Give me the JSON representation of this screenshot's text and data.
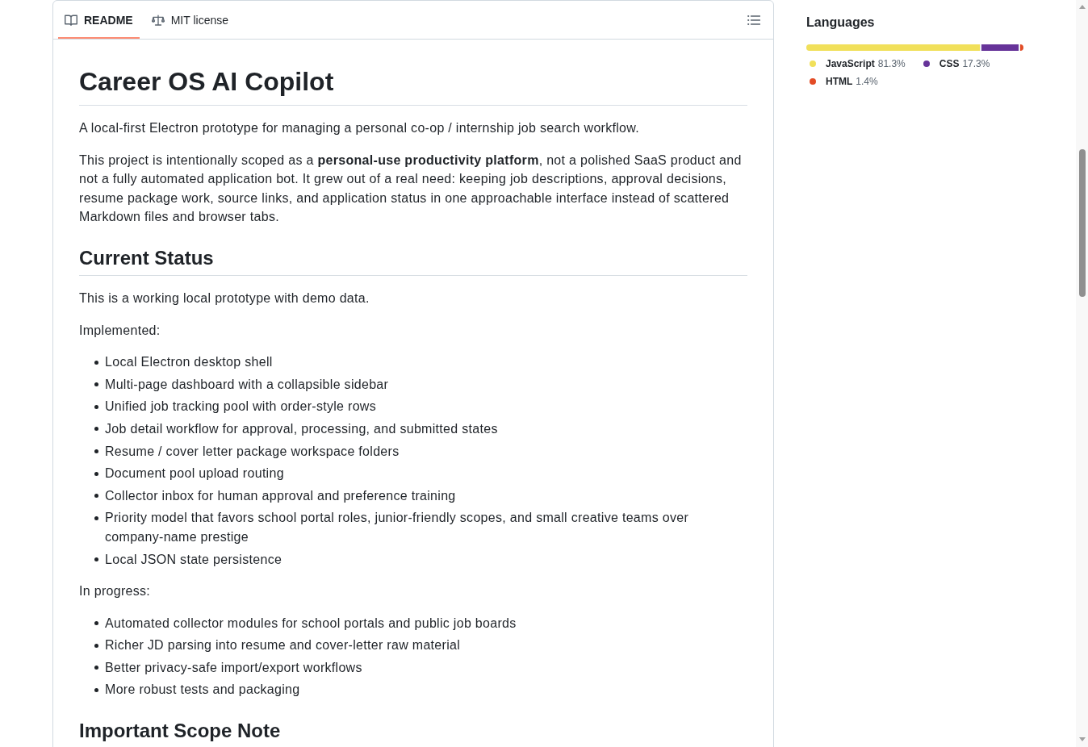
{
  "tabs": [
    {
      "kind": "readme",
      "label": "README",
      "selected": true
    },
    {
      "kind": "license",
      "label": "MIT license",
      "selected": false
    }
  ],
  "readme": {
    "blocks": [
      {
        "kind": "h1",
        "text": "Career OS AI Copilot"
      },
      {
        "kind": "p",
        "text": "A local-first Electron prototype for managing a personal co-op / internship job search workflow."
      },
      {
        "kind": "p",
        "text": "This project is intentionally scoped as a **personal-use productivity platform**, not a polished SaaS product and not a fully automated application bot. It grew out of a real need: keeping job descriptions, approval decisions, resume package work, source links, and application status in one approachable interface instead of scattered Markdown files and browser tabs."
      },
      {
        "kind": "h2",
        "text": "Current Status"
      },
      {
        "kind": "p",
        "text": "This is a working local prototype with demo data."
      },
      {
        "kind": "p",
        "text": "Implemented:"
      },
      {
        "kind": "list",
        "items": [
          "Local Electron desktop shell",
          "Multi-page dashboard with a collapsible sidebar",
          "Unified job tracking pool with order-style rows",
          "Job detail workflow for approval, processing, and submitted states",
          "Resume / cover letter package workspace folders",
          "Document pool upload routing",
          "Collector inbox for human approval and preference training",
          "Priority model that favors school portal roles, junior-friendly scopes, and small creative teams over company-name prestige",
          "Local JSON state persistence"
        ]
      },
      {
        "kind": "p",
        "text": "In progress:"
      },
      {
        "kind": "list",
        "items": [
          "Automated collector modules for school portals and public job boards",
          "Richer JD parsing into resume and cover-letter raw material",
          "Better privacy-safe import/export workflows",
          "More robust tests and packaging"
        ]
      },
      {
        "kind": "h2",
        "text": "Important Scope Note"
      }
    ]
  },
  "languages": {
    "title": "Languages",
    "items": [
      {
        "name": "JavaScript",
        "percent": "81.3%",
        "color": "#f1e05a",
        "level": 0.813
      },
      {
        "name": "CSS",
        "percent": "17.3%",
        "color": "#663399",
        "level": 0.173
      },
      {
        "name": "HTML",
        "percent": "1.4%",
        "color": "#e34c26",
        "level": 0.014
      }
    ]
  }
}
